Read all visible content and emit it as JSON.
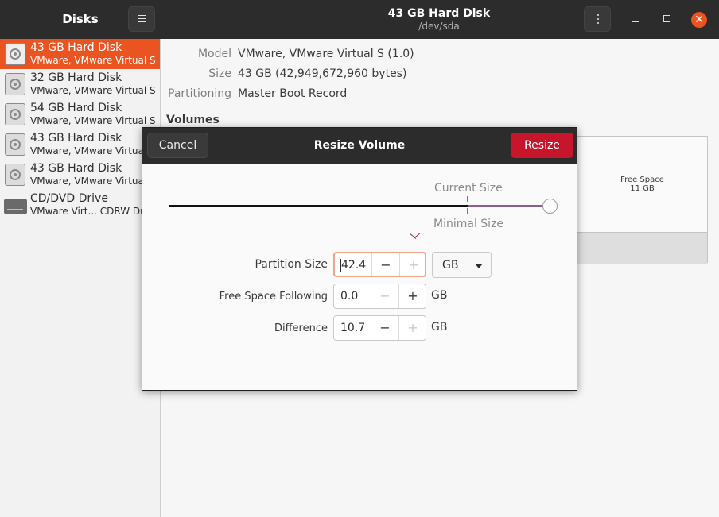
{
  "titlebar": {
    "app_title": "Disks",
    "window_title": "43 GB Hard Disk",
    "window_subtitle": "/dev/sda",
    "close_glyph": "✕"
  },
  "sidebar": {
    "items": [
      {
        "name": "43 GB Hard Disk",
        "sub": "VMware, VMware Virtual S",
        "icon": "hard-disk-icon"
      },
      {
        "name": "32 GB Hard Disk",
        "sub": "VMware, VMware Virtual S",
        "icon": "hard-disk-icon"
      },
      {
        "name": "54 GB Hard Disk",
        "sub": "VMware, VMware Virtual S",
        "icon": "hard-disk-icon"
      },
      {
        "name": "43 GB Hard Disk",
        "sub": "VMware, VMware Virtual S",
        "icon": "hard-disk-icon"
      },
      {
        "name": "43 GB Hard Disk",
        "sub": "VMware, VMware Virtual S",
        "icon": "hard-disk-icon"
      },
      {
        "name": "CD/DVD Drive",
        "sub": "VMware Virt... CDRW Drive",
        "icon": "optical-drive-icon"
      }
    ]
  },
  "details": {
    "model_label": "Model",
    "model_value": "VMware, VMware Virtual S (1.0)",
    "size_label": "Size",
    "size_value": "43 GB (42,949,672,960 bytes)",
    "partitioning_label": "Partitioning",
    "partitioning_value": "Master Boot Record",
    "volumes_title": "Volumes",
    "free_space_label": "Free Space",
    "free_space_value": "11 GB"
  },
  "dialog": {
    "title": "Resize Volume",
    "cancel_label": "Cancel",
    "resize_label": "Resize",
    "current_size_label": "Current Size",
    "minimal_size_label": "Minimal Size",
    "slider_fraction": 0.785,
    "partition_size_label": "Partition Size",
    "partition_size_value": "42.4",
    "free_space_following_label": "Free Space Following",
    "free_space_following_value": "0.0",
    "difference_label": "Difference",
    "difference_value": "10.7",
    "unit_selected": "GB",
    "unit_label": "GB",
    "minus_glyph": "−",
    "plus_glyph": "+"
  },
  "colors": {
    "accent": "#e95420",
    "destructive": "#c7162b",
    "slider_remaining": "#8b5e8b"
  }
}
